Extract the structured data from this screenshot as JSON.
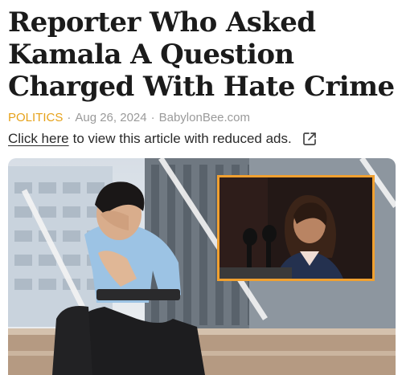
{
  "article": {
    "headline": "Reporter Who Asked Kamala A Question Charged With Hate Crime",
    "category": "POLITICS",
    "separator": "·",
    "date": "Aug 26, 2024",
    "source": "BabylonBee.com"
  },
  "ads_notice": {
    "link_text": "Click here",
    "rest_text": "to view this article with reduced ads."
  },
  "icons": {
    "external": "external-link-icon"
  },
  "colors": {
    "category": "#e6a21a",
    "inset_border": "#f0a030"
  }
}
